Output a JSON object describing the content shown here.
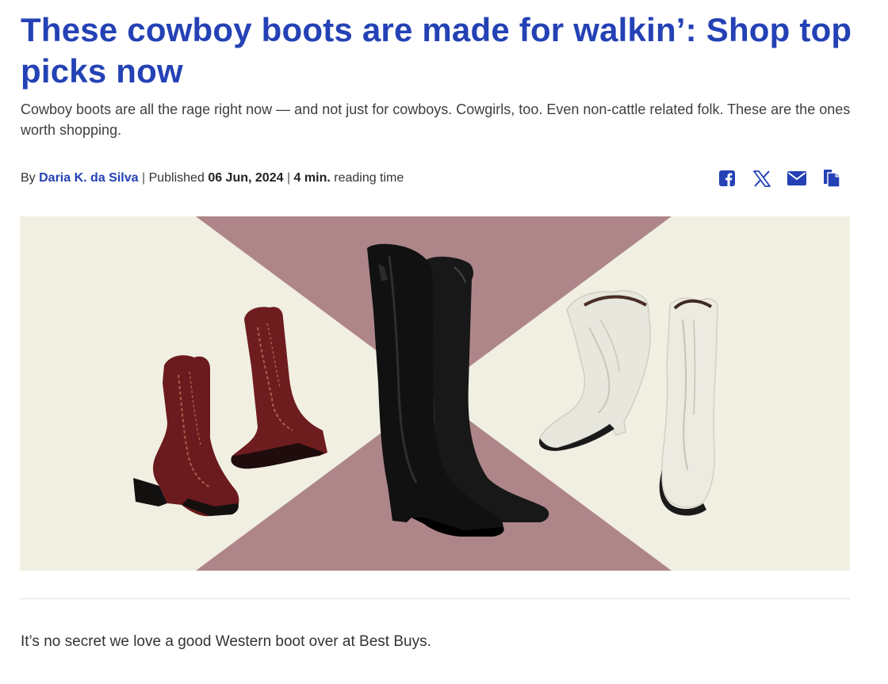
{
  "article": {
    "headline": "These cowboy boots are made for walkin’: Shop top picks now",
    "subheadline": "Cowboy boots are all the rage right now — and not just for cowboys. Cowgirls, too. Even non-cattle related folk. These are the ones worth shopping.",
    "byline": {
      "by_label": "By",
      "author": "Daria K. da Silva",
      "separator": "|",
      "published_label": "Published",
      "date": "06 Jun, 2024",
      "reading_value": "4 min.",
      "reading_label": "reading time"
    },
    "share": {
      "icons": [
        "facebook-icon",
        "x-icon",
        "email-icon",
        "copy-link-icon"
      ],
      "color": "#2442b5"
    },
    "hero": {
      "background_color": "#f1efe2",
      "triangle_color": "#ae868a",
      "boots": [
        "burgundy-cowboy-boots",
        "black-tall-boots",
        "white-cowboy-boots"
      ]
    },
    "first_paragraph": "It’s no secret we love a good Western boot over at Best Buys."
  }
}
